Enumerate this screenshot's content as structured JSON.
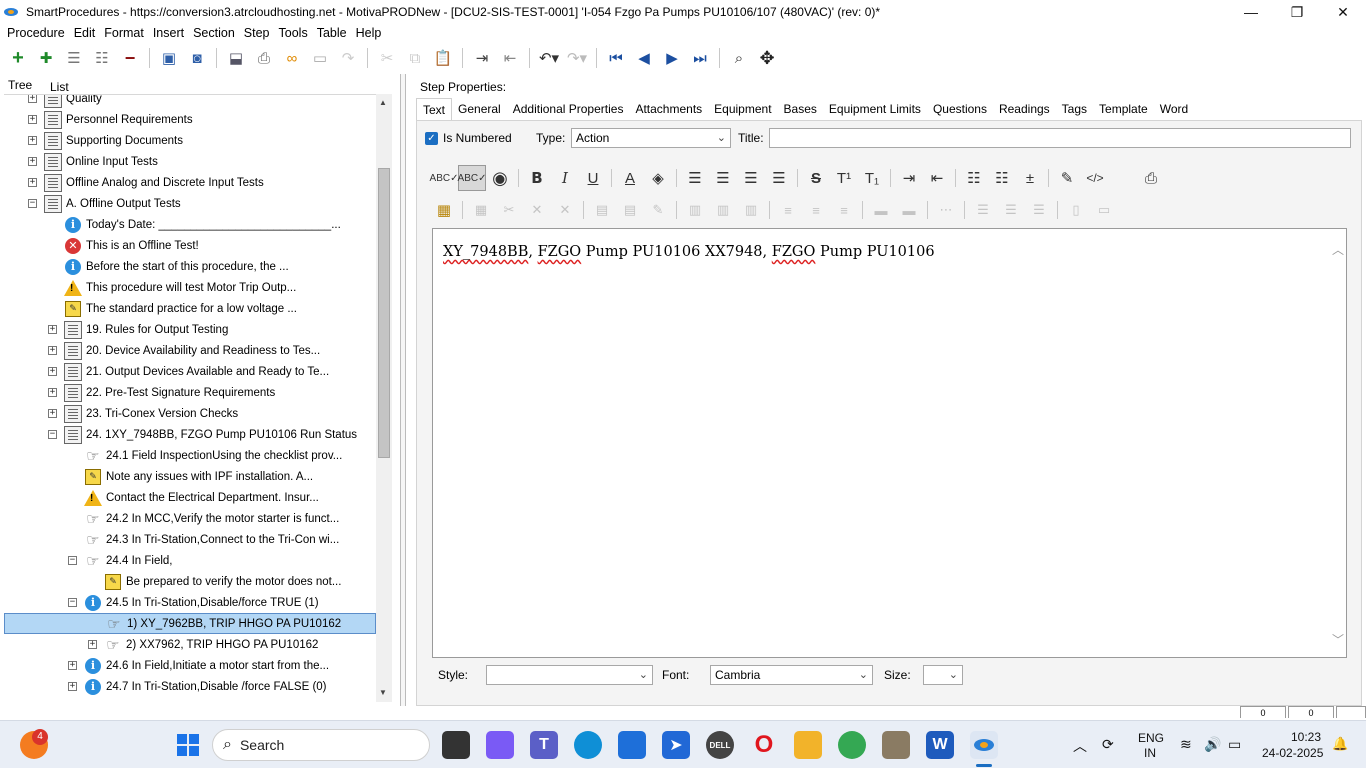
{
  "window": {
    "title": "SmartProcedures - https://conversion3.atrcloudhosting.net - MotivaPRODNew - [DCU2-SIS-TEST-0001] 'I-054 Fzgo Pa Pumps PU10106/107 (480VAC)' (rev: 0)*",
    "minimize": "—",
    "restore": "❐",
    "close": "✕"
  },
  "menu": [
    "Procedure",
    "Edit",
    "Format",
    "Insert",
    "Section",
    "Step",
    "Tools",
    "Table",
    "Help"
  ],
  "left_tabs": {
    "tree": "Tree",
    "list": "List"
  },
  "tree": [
    {
      "label": "Quality",
      "icon": "doc",
      "level": 0,
      "expander": "+"
    },
    {
      "label": "Personnel Requirements",
      "icon": "doc",
      "level": 0,
      "expander": "+"
    },
    {
      "label": "Supporting Documents",
      "icon": "doc",
      "level": 0,
      "expander": "+"
    },
    {
      "label": "Online Input Tests",
      "icon": "doc",
      "level": 0,
      "expander": "+"
    },
    {
      "label": "Offline Analog and Discrete Input Tests",
      "icon": "doc",
      "level": 0,
      "expander": "+"
    },
    {
      "label": "A. Offline Output Tests",
      "icon": "doc",
      "level": 0,
      "expander": "−"
    },
    {
      "label": "Today's Date: ___________________________...",
      "icon": "info",
      "level": 1,
      "expander": ""
    },
    {
      "label": "This is an Offline Test!",
      "icon": "error",
      "level": 1,
      "expander": ""
    },
    {
      "label": "Before the start of this procedure, the ...",
      "icon": "info",
      "level": 1,
      "expander": ""
    },
    {
      "label": "This procedure will test Motor Trip Outp...",
      "icon": "warn",
      "level": 1,
      "expander": ""
    },
    {
      "label": "The standard practice for a low voltage ...",
      "icon": "note",
      "level": 1,
      "expander": ""
    },
    {
      "label": "19. Rules for Output Testing",
      "icon": "doc",
      "level": 1,
      "expander": "+"
    },
    {
      "label": "20. Device Availability and Readiness to Tes...",
      "icon": "doc",
      "level": 1,
      "expander": "+"
    },
    {
      "label": "21. Output Devices Available and Ready to Te...",
      "icon": "doc",
      "level": 1,
      "expander": "+"
    },
    {
      "label": "22. Pre-Test Signature Requirements",
      "icon": "doc",
      "level": 1,
      "expander": "+"
    },
    {
      "label": "23. Tri-Conex Version Checks",
      "icon": "doc",
      "level": 1,
      "expander": "+"
    },
    {
      "label": "24. 1XY_7948BB, FZGO Pump PU10106 Run Status",
      "icon": "doc",
      "level": 1,
      "expander": "−"
    },
    {
      "label": "24.1 Field InspectionUsing the checklist prov...",
      "icon": "hand",
      "level": 2,
      "expander": ""
    },
    {
      "label": "Note any issues with IPF installation. A...",
      "icon": "note",
      "level": 2,
      "expander": ""
    },
    {
      "label": "Contact the Electrical Department. Insur...",
      "icon": "warn",
      "level": 2,
      "expander": ""
    },
    {
      "label": "24.2 In MCC,Verify the motor starter is funct...",
      "icon": "hand",
      "level": 2,
      "expander": ""
    },
    {
      "label": "24.3 In Tri-Station,Connect to the Tri-Con wi...",
      "icon": "hand",
      "level": 2,
      "expander": ""
    },
    {
      "label": "24.4 In Field,",
      "icon": "hand",
      "level": 2,
      "expander": "−"
    },
    {
      "label": "Be prepared to verify the motor does not...",
      "icon": "note",
      "level": 3,
      "expander": ""
    },
    {
      "label": "24.5 In Tri-Station,Disable/force TRUE (1)",
      "icon": "info",
      "level": 2,
      "expander": "−"
    },
    {
      "label": "1) XY_7962BB, TRIP HHGO PA PU10162",
      "icon": "hand",
      "level": 3,
      "expander": "",
      "selected": true
    },
    {
      "label": "2) XX7962, TRIP HHGO PA PU10162",
      "icon": "hand",
      "level": 3,
      "expander": "+"
    },
    {
      "label": "24.6 In Field,Initiate a motor start from the...",
      "icon": "info",
      "level": 2,
      "expander": "+"
    },
    {
      "label": "24.7 In Tri-Station,Disable /force FALSE (0)",
      "icon": "info",
      "level": 2,
      "expander": "+"
    }
  ],
  "step_properties": {
    "label": "Step Properties:",
    "tabs": [
      "Text",
      "General",
      "Additional Properties",
      "Attachments",
      "Equipment",
      "Bases",
      "Equipment Limits",
      "Questions",
      "Readings",
      "Tags",
      "Template",
      "Word"
    ],
    "is_numbered_label": "Is Numbered",
    "is_numbered": true,
    "type_label": "Type:",
    "type_value": "Action",
    "title_label": "Title:",
    "title_value": ""
  },
  "editor": {
    "parts": [
      {
        "text": "XY_7948BB",
        "spell": true
      },
      {
        "text": ", ",
        "spell": false
      },
      {
        "text": "FZGO",
        "spell": true
      },
      {
        "text": " Pump PU10106 XX7948, ",
        "spell": false
      },
      {
        "text": "FZGO",
        "spell": true
      },
      {
        "text": " Pump PU10106",
        "spell": false
      }
    ]
  },
  "bottom": {
    "style_label": "Style:",
    "style_value": "",
    "font_label": "Font:",
    "font_value": "Cambria",
    "size_label": "Size:",
    "size_value": ""
  },
  "status_strip": [
    "0",
    "0"
  ],
  "taskbar": {
    "search_placeholder": "Search",
    "notification_count": "4",
    "language": "ENG",
    "region": "IN",
    "time": "10:23",
    "date": "24-02-2025"
  },
  "colors": {
    "accent": "#1b6ec2",
    "selection": "#b3d7f5",
    "info_icon": "#2b8fdd",
    "error_icon": "#d93737",
    "warn_icon": "#f0b417"
  }
}
